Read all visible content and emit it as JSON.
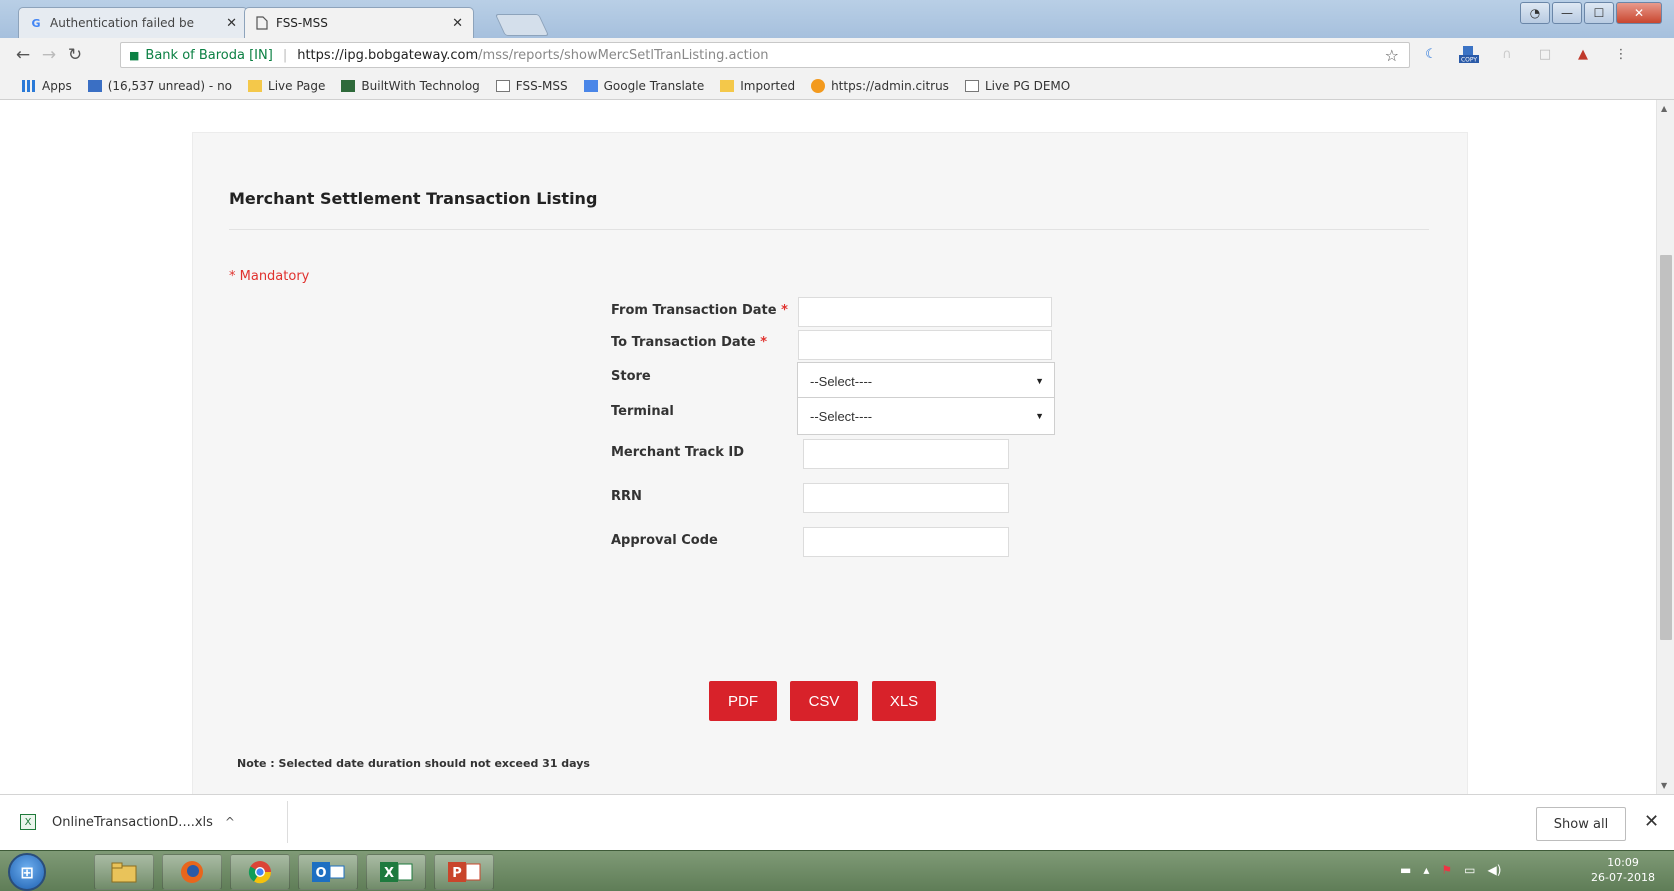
{
  "browser": {
    "tabs": [
      {
        "label": "Authentication failed be",
        "icon": "google-icon"
      },
      {
        "label": "FSS-MSS",
        "icon": "page-icon"
      }
    ],
    "site_name": "Bank of Baroda [IN]",
    "url_host": "https://ipg.bobgateway.com",
    "url_path": "/mss/reports/showMercSetlTranListing.action",
    "extensions": [
      "star-icon",
      "moon-icon",
      "copy-icon",
      "ext-icon-1",
      "ext-icon-2",
      "ext-icon-3",
      "menu-icon"
    ],
    "copy_badge": "COPY"
  },
  "bookmarks": [
    {
      "label": "Apps",
      "icon": "apps-grid-icon"
    },
    {
      "label": "(16,537 unread) - no",
      "icon": "mail-icon"
    },
    {
      "label": "Live Page",
      "icon": "folder-icon"
    },
    {
      "label": "BuiltWith Technolog",
      "icon": "builtwith-icon"
    },
    {
      "label": "FSS-MSS",
      "icon": "page-icon"
    },
    {
      "label": "Google Translate",
      "icon": "translate-icon"
    },
    {
      "label": "Imported",
      "icon": "folder-icon"
    },
    {
      "label": "https://admin.citrus",
      "icon": "citrus-icon"
    },
    {
      "label": "Live PG DEMO",
      "icon": "page-icon"
    }
  ],
  "page": {
    "title": "Merchant Settlement Transaction Listing",
    "mandatory": "* Mandatory",
    "fields": {
      "from_date_label": "From Transaction Date",
      "to_date_label": "To Transaction Date",
      "store_label": "Store",
      "store_value": "--Select----",
      "terminal_label": "Terminal",
      "terminal_value": "--Select----",
      "track_id_label": "Merchant Track ID",
      "rrn_label": "RRN",
      "approval_label": "Approval Code",
      "required_mark": "*"
    },
    "buttons": {
      "pdf": "PDF",
      "csv": "CSV",
      "xls": "XLS"
    },
    "note": "Note : Selected date duration should not exceed 31 days"
  },
  "downloads": {
    "file_name": "OnlineTransactionD....xls",
    "show_all": "Show all"
  },
  "taskbar": {
    "time": "10:09",
    "date": "26-07-2018",
    "apps": [
      "windows-start-icon",
      "file-explorer-icon",
      "firefox-icon",
      "chrome-icon",
      "outlook-icon",
      "excel-icon",
      "powerpoint-icon"
    ]
  }
}
